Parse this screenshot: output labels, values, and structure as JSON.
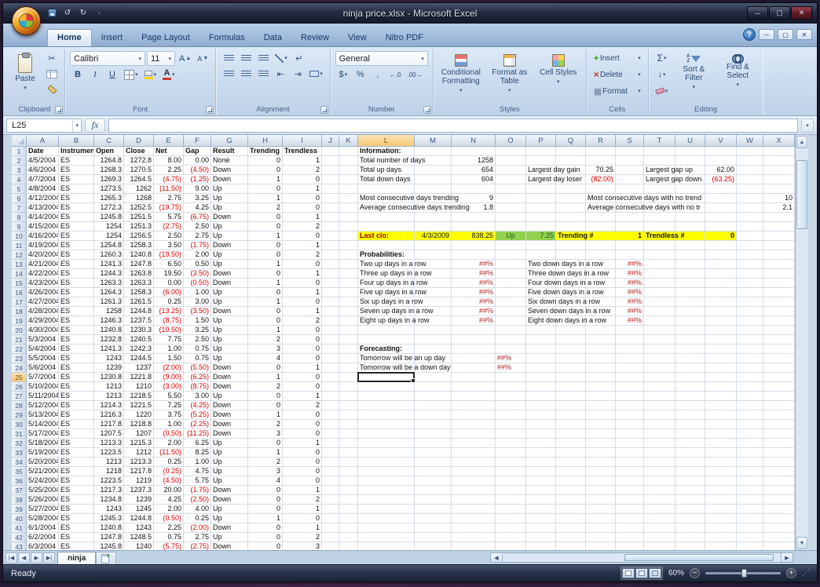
{
  "window": {
    "title": "ninja price.xlsx - Microsoft Excel"
  },
  "ribbon": {
    "tabs": [
      {
        "label": "Home",
        "active": true
      },
      {
        "label": "Insert"
      },
      {
        "label": "Page Layout"
      },
      {
        "label": "Formulas"
      },
      {
        "label": "Data"
      },
      {
        "label": "Review"
      },
      {
        "label": "View"
      },
      {
        "label": "Nitro PDF"
      }
    ],
    "clipboard": {
      "label": "Clipboard",
      "paste": "Paste"
    },
    "font": {
      "label": "Font",
      "family": "Calibri",
      "size": "11",
      "bold": "B",
      "italic": "I",
      "underline": "U"
    },
    "alignment": {
      "label": "Alignment"
    },
    "number": {
      "label": "Number",
      "format": "General",
      "currency": "$",
      "percent": "%",
      "comma": ","
    },
    "styles": {
      "label": "Styles",
      "conditional": "Conditional Formatting",
      "format_table": "Format as Table",
      "cell_styles": "Cell Styles"
    },
    "cells": {
      "label": "Cells",
      "insert": "Insert",
      "delete": "Delete",
      "format": "Format"
    },
    "editing": {
      "label": "Editing",
      "autosum": "Σ",
      "sort_filter": "Sort & Filter",
      "find_select": "Find & Select"
    }
  },
  "formula_bar": {
    "name_box": "L25",
    "fx_label": "fx",
    "input_value": ""
  },
  "sheet": {
    "row_count": 43,
    "selection": {
      "ref": "L25",
      "row": 25,
      "col": "L"
    },
    "columns": [
      {
        "letter": "A",
        "width": 41
      },
      {
        "letter": "B",
        "width": 45
      },
      {
        "letter": "C",
        "width": 38
      },
      {
        "letter": "D",
        "width": 38
      },
      {
        "letter": "E",
        "width": 38
      },
      {
        "letter": "F",
        "width": 35
      },
      {
        "letter": "G",
        "width": 47
      },
      {
        "letter": "H",
        "width": 44
      },
      {
        "letter": "I",
        "width": 50
      },
      {
        "letter": "J",
        "width": 22
      },
      {
        "letter": "K",
        "width": 24
      },
      {
        "letter": "L",
        "width": 72
      },
      {
        "letter": "M",
        "width": 47
      },
      {
        "letter": "N",
        "width": 56
      },
      {
        "letter": "O",
        "width": 39
      },
      {
        "letter": "P",
        "width": 38
      },
      {
        "letter": "Q",
        "width": 38
      },
      {
        "letter": "R",
        "width": 38
      },
      {
        "letter": "S",
        "width": 36
      },
      {
        "letter": "T",
        "width": 40
      },
      {
        "letter": "U",
        "width": 38
      },
      {
        "letter": "V",
        "width": 40
      },
      {
        "letter": "W",
        "width": 34
      },
      {
        "letter": "X",
        "width": 40
      }
    ],
    "table_headers": [
      "Date",
      "Instrument",
      "Open",
      "Close",
      "Net",
      "Gap",
      "Result",
      "Trending",
      "Trendless"
    ],
    "table_rows": [
      [
        "4/5/2004",
        "ES",
        "1264.8",
        "1272.8",
        "8.00",
        "0.00",
        "None",
        "0",
        "1"
      ],
      [
        "4/6/2004",
        "ES",
        "1268.3",
        "1270.5",
        "2.25",
        "(4.50)",
        "Down",
        "0",
        "2"
      ],
      [
        "4/7/2004",
        "ES",
        "1269.3",
        "1264.5",
        "(4.75)",
        "(1.25)",
        "Down",
        "1",
        "0"
      ],
      [
        "4/8/2004",
        "ES",
        "1273.5",
        "1262",
        "(11.50)",
        "9.00",
        "Up",
        "0",
        "1"
      ],
      [
        "4/12/2004",
        "ES",
        "1265.3",
        "1268",
        "2.75",
        "3.25",
        "Up",
        "1",
        "0"
      ],
      [
        "4/13/2004",
        "ES",
        "1272.3",
        "1252.5",
        "(19.75)",
        "4.25",
        "Up",
        "2",
        "0"
      ],
      [
        "4/14/2004",
        "ES",
        "1245.8",
        "1251.5",
        "5.75",
        "(6.75)",
        "Down",
        "0",
        "1"
      ],
      [
        "4/15/2004",
        "ES",
        "1254",
        "1251.3",
        "(2.75)",
        "2.50",
        "Up",
        "0",
        "2"
      ],
      [
        "4/16/2004",
        "ES",
        "1254",
        "1256.5",
        "2.50",
        "2.75",
        "Up",
        "1",
        "0"
      ],
      [
        "4/19/2004",
        "ES",
        "1254.8",
        "1258.3",
        "3.50",
        "(1.75)",
        "Down",
        "0",
        "1"
      ],
      [
        "4/20/2004",
        "ES",
        "1260.3",
        "1240.8",
        "(19.50)",
        "2.00",
        "Up",
        "0",
        "2"
      ],
      [
        "4/21/2004",
        "ES",
        "1241.3",
        "1247.8",
        "6.50",
        "0.50",
        "Up",
        "1",
        "0"
      ],
      [
        "4/22/2004",
        "ES",
        "1244.3",
        "1263.8",
        "19.50",
        "(3.50)",
        "Down",
        "0",
        "1"
      ],
      [
        "4/23/2004",
        "ES",
        "1263.3",
        "1263.3",
        "0.00",
        "(0.50)",
        "Down",
        "1",
        "0"
      ],
      [
        "4/26/2004",
        "ES",
        "1264.3",
        "1258.3",
        "(6.00)",
        "1.00",
        "Up",
        "0",
        "1"
      ],
      [
        "4/27/2004",
        "ES",
        "1261.3",
        "1261.5",
        "0.25",
        "3.00",
        "Up",
        "1",
        "0"
      ],
      [
        "4/28/2004",
        "ES",
        "1258",
        "1244.8",
        "(13.25)",
        "(3.50)",
        "Down",
        "0",
        "1"
      ],
      [
        "4/29/2004",
        "ES",
        "1246.3",
        "1237.5",
        "(8.75)",
        "1.50",
        "Up",
        "0",
        "2"
      ],
      [
        "4/30/2004",
        "ES",
        "1240.8",
        "1230.3",
        "(10.50)",
        "3.25",
        "Up",
        "1",
        "0"
      ],
      [
        "5/3/2004",
        "ES",
        "1232.8",
        "1240.5",
        "7.75",
        "2.50",
        "Up",
        "2",
        "0"
      ],
      [
        "5/4/2004",
        "ES",
        "1241.3",
        "1242.3",
        "1.00",
        "0.75",
        "Up",
        "3",
        "0"
      ],
      [
        "5/5/2004",
        "ES",
        "1243",
        "1244.5",
        "1.50",
        "0.75",
        "Up",
        "4",
        "0"
      ],
      [
        "5/6/2004",
        "ES",
        "1239",
        "1237",
        "(2.00)",
        "(5.50)",
        "Down",
        "0",
        "1"
      ],
      [
        "5/7/2004",
        "ES",
        "1230.8",
        "1221.8",
        "(9.00)",
        "(6.25)",
        "Down",
        "1",
        "0"
      ],
      [
        "5/10/2004",
        "ES",
        "1213",
        "1210",
        "(3.00)",
        "(8.75)",
        "Down",
        "2",
        "0"
      ],
      [
        "5/11/2004",
        "ES",
        "1213",
        "1218.5",
        "5.50",
        "3.00",
        "Up",
        "0",
        "1"
      ],
      [
        "5/12/2004",
        "ES",
        "1214.3",
        "1221.5",
        "7.25",
        "(4.25)",
        "Down",
        "0",
        "2"
      ],
      [
        "5/13/2004",
        "ES",
        "1216.3",
        "1220",
        "3.75",
        "(5.25)",
        "Down",
        "1",
        "0"
      ],
      [
        "5/14/2004",
        "ES",
        "1217.8",
        "1218.8",
        "1.00",
        "(2.25)",
        "Down",
        "2",
        "0"
      ],
      [
        "5/17/2004",
        "ES",
        "1207.5",
        "1207",
        "(0.50)",
        "(11.25)",
        "Down",
        "3",
        "0"
      ],
      [
        "5/18/2004",
        "ES",
        "1213.3",
        "1215.3",
        "2.00",
        "6.25",
        "Up",
        "0",
        "1"
      ],
      [
        "5/19/2004",
        "ES",
        "1223.5",
        "1212",
        "(11.50)",
        "8.25",
        "Up",
        "1",
        "0"
      ],
      [
        "5/20/2004",
        "ES",
        "1213",
        "1213.3",
        "0.25",
        "1.00",
        "Up",
        "2",
        "0"
      ],
      [
        "5/21/2004",
        "ES",
        "1218",
        "1217.8",
        "(0.25)",
        "4.75",
        "Up",
        "3",
        "0"
      ],
      [
        "5/24/2004",
        "ES",
        "1223.5",
        "1219",
        "(4.50)",
        "5.75",
        "Up",
        "4",
        "0"
      ],
      [
        "5/25/2004",
        "ES",
        "1217.3",
        "1237.3",
        "20.00",
        "(1.75)",
        "Down",
        "0",
        "1"
      ],
      [
        "5/26/2004",
        "ES",
        "1234.8",
        "1239",
        "4.25",
        "(2.50)",
        "Down",
        "0",
        "2"
      ],
      [
        "5/27/2004",
        "ES",
        "1243",
        "1245",
        "2.00",
        "4.00",
        "Up",
        "0",
        "1"
      ],
      [
        "5/28/2004",
        "ES",
        "1245.3",
        "1244.8",
        "(0.50)",
        "0.25",
        "Up",
        "1",
        "0"
      ],
      [
        "6/1/2004",
        "ES",
        "1240.8",
        "1243",
        "2.25",
        "(2.00)",
        "Down",
        "0",
        "1"
      ],
      [
        "6/2/2004",
        "ES",
        "1247.8",
        "1248.5",
        "0.75",
        "2.75",
        "Up",
        "0",
        "2"
      ],
      [
        "6/3/2004",
        "ES",
        "1245.8",
        "1240",
        "(5.75)",
        "(2.75)",
        "Down",
        "0",
        "3"
      ]
    ],
    "info": {
      "L1": {
        "t": "Information:",
        "b": 1
      },
      "L2": {
        "t": "Total number of days"
      },
      "N2": {
        "t": "1258",
        "a": "r"
      },
      "L3": {
        "t": "Total up days"
      },
      "N3": {
        "t": "654",
        "a": "r"
      },
      "P3": {
        "t": "Largest day gain"
      },
      "R3": {
        "t": "70.25",
        "a": "r"
      },
      "T3": {
        "t": "Largest gap up"
      },
      "V3": {
        "t": "62.00",
        "a": "r"
      },
      "L4": {
        "t": "Total down days"
      },
      "N4": {
        "t": "604",
        "a": "r"
      },
      "P4": {
        "t": "Largest day loser"
      },
      "R4": {
        "t": "(82.00)",
        "a": "r"
      },
      "T4": {
        "t": "Largest gap down"
      },
      "V4": {
        "t": "(63.25)",
        "a": "r"
      },
      "L6": {
        "t": "Most consecutive days trending"
      },
      "N6": {
        "t": "9",
        "a": "r"
      },
      "R6": {
        "t": "Most consecutive days with no trend"
      },
      "X6": {
        "t": "10",
        "a": "r"
      },
      "L7": {
        "t": "Average consecutive days trending"
      },
      "N7": {
        "t": "1.8",
        "a": "r"
      },
      "R7": {
        "t": "Average consecutive days with no tr"
      },
      "X7": {
        "t": "2.1",
        "a": "r"
      },
      "L10": {
        "t": "Last clo:",
        "b": 1,
        "c": "#9c0006",
        "bg": "#ffff00"
      },
      "M10": {
        "t": "4/3/2009",
        "a": "r",
        "bg": "#ffff00"
      },
      "N10": {
        "t": "838.25",
        "a": "r",
        "bg": "#ffff00"
      },
      "O10": {
        "t": "Up",
        "a": "c",
        "bg": "#92d050",
        "c": "#1f5b13"
      },
      "P10": {
        "t": "7.25",
        "a": "r",
        "bg": "#92d050",
        "c": "#1f5b13"
      },
      "Q10": {
        "t": "Trending #",
        "b": 1,
        "bg": "#ffff00"
      },
      "R10": {
        "t": "",
        "bg": "#ffff00"
      },
      "S10": {
        "t": "1",
        "a": "r",
        "b": 1,
        "bg": "#ffff00"
      },
      "T10": {
        "t": "Trendless #",
        "b": 1,
        "bg": "#ffff00"
      },
      "U10": {
        "t": "",
        "bg": "#ffff00"
      },
      "V10": {
        "t": "0",
        "a": "r",
        "b": 1,
        "bg": "#ffff00"
      },
      "L12": {
        "t": "Probabilities:",
        "b": 1
      },
      "L13": {
        "t": "Two up days in a row"
      },
      "N13": {
        "t": "##%",
        "a": "r",
        "c": "#b22222"
      },
      "P13": {
        "t": "Two down days in a row"
      },
      "S13": {
        "t": "##%",
        "a": "r",
        "c": "#b22222"
      },
      "L14": {
        "t": "Three up days in a row"
      },
      "N14": {
        "t": "##%",
        "a": "r",
        "c": "#b22222"
      },
      "P14": {
        "t": "Three down days in a row"
      },
      "S14": {
        "t": "##%",
        "a": "r",
        "c": "#b22222"
      },
      "L15": {
        "t": "Four up days in a row"
      },
      "N15": {
        "t": "##%",
        "a": "r",
        "c": "#b22222"
      },
      "P15": {
        "t": "Four down days in a row"
      },
      "S15": {
        "t": "##%",
        "a": "r",
        "c": "#b22222"
      },
      "L16": {
        "t": "Five up days in a row"
      },
      "N16": {
        "t": "##%",
        "a": "r",
        "c": "#b22222"
      },
      "P16": {
        "t": "Five down days in a row"
      },
      "S16": {
        "t": "##%",
        "a": "r",
        "c": "#b22222"
      },
      "L17": {
        "t": "Six up days in a row"
      },
      "N17": {
        "t": "##%",
        "a": "r",
        "c": "#b22222"
      },
      "P17": {
        "t": "Six down days in a row"
      },
      "S17": {
        "t": "##%",
        "a": "r",
        "c": "#b22222"
      },
      "L18": {
        "t": "Seven up days in a row"
      },
      "N18": {
        "t": "##%",
        "a": "r",
        "c": "#b22222"
      },
      "P18": {
        "t": "Seven down days in a row"
      },
      "S18": {
        "t": "##%",
        "a": "r",
        "c": "#b22222"
      },
      "L19": {
        "t": "Eight up days in a row"
      },
      "N19": {
        "t": "##%",
        "a": "r",
        "c": "#b22222"
      },
      "P19": {
        "t": "Eight down days in a row"
      },
      "S19": {
        "t": "##%",
        "a": "r",
        "c": "#b22222"
      },
      "L22": {
        "t": "Forecasting:",
        "b": 1
      },
      "L23": {
        "t": "Tomorrow will be an up day"
      },
      "O23": {
        "t": "##%",
        "c": "#b22222"
      },
      "L24": {
        "t": "Tomorrow will be a down day"
      },
      "O24": {
        "t": "##%",
        "c": "#b22222"
      }
    }
  },
  "sheet_tabs": {
    "sheets": [
      {
        "name": "ninja",
        "active": true
      }
    ]
  },
  "status": {
    "mode": "Ready",
    "zoom": "60%"
  }
}
